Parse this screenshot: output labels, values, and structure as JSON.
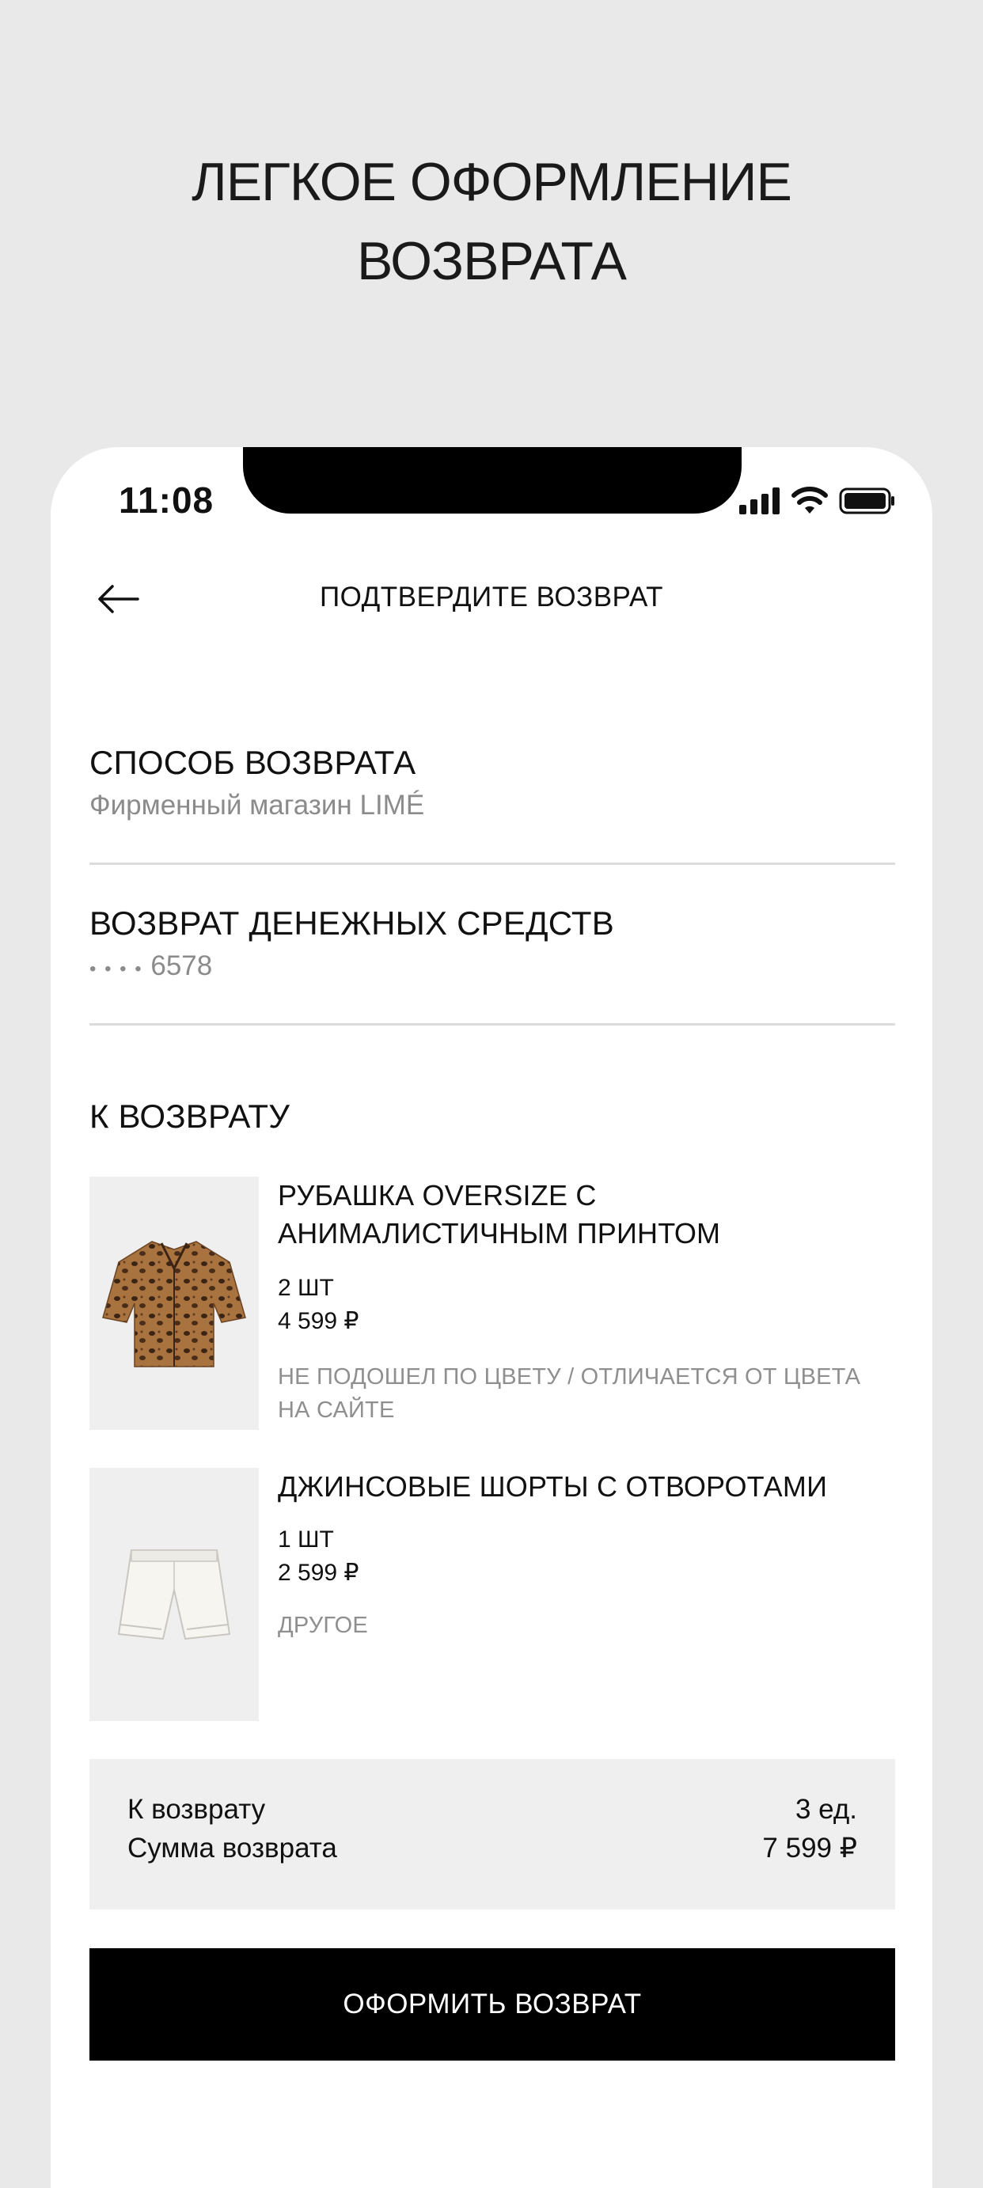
{
  "promo": {
    "headline_line1": "ЛЕГКОЕ ОФОРМЛЕНИЕ",
    "headline_line2": "ВОЗВРАТА"
  },
  "status_bar": {
    "time": "11:08",
    "icons": [
      "signal-icon",
      "wifi-icon",
      "battery-icon"
    ]
  },
  "nav": {
    "back_icon": "arrow-left-icon",
    "title": "ПОДТВЕРДИТЕ ВОЗВРАТ"
  },
  "return_method": {
    "title": "СПОСОБ ВОЗВРАТА",
    "value": "Фирменный магазин LIMÉ"
  },
  "refund": {
    "title": "ВОЗВРАТ ДЕНЕЖНЫХ СРЕДСТВ",
    "dots": "• • • •",
    "card_last4": "6578"
  },
  "items_section": {
    "title": "К ВОЗВРАТУ",
    "items": [
      {
        "name": "РУБАШКА OVERSIZE С АНИМАЛИСТИЧНЫМ ПРИНТОМ",
        "qty": "2 ШТ",
        "price": "4 599 ₽",
        "reason": "НЕ ПОДОШЕЛ ПО ЦВЕТУ / ОТЛИЧАЕТСЯ ОТ ЦВЕТА НА САЙТЕ",
        "image": "leopard-shirt-image"
      },
      {
        "name": "ДЖИНСОВЫЕ ШОРТЫ С ОТВОРОТАМИ",
        "qty": "1 ШТ",
        "price": "2 599 ₽",
        "reason": "ДРУГОЕ",
        "image": "white-shorts-image"
      }
    ]
  },
  "summary": {
    "count_label": "К возврату",
    "count_value": "3 ед.",
    "sum_label": "Сумма возврата",
    "sum_value": "7 599 ₽"
  },
  "cta": {
    "label": "ОФОРМИТЬ ВОЗВРАТ"
  },
  "colors": {
    "background": "#e9e9e9",
    "card": "#ffffff",
    "muted_text": "#8b8b8b",
    "summary_bg": "#efefef",
    "cta_bg": "#000000",
    "cta_text": "#ffffff"
  }
}
